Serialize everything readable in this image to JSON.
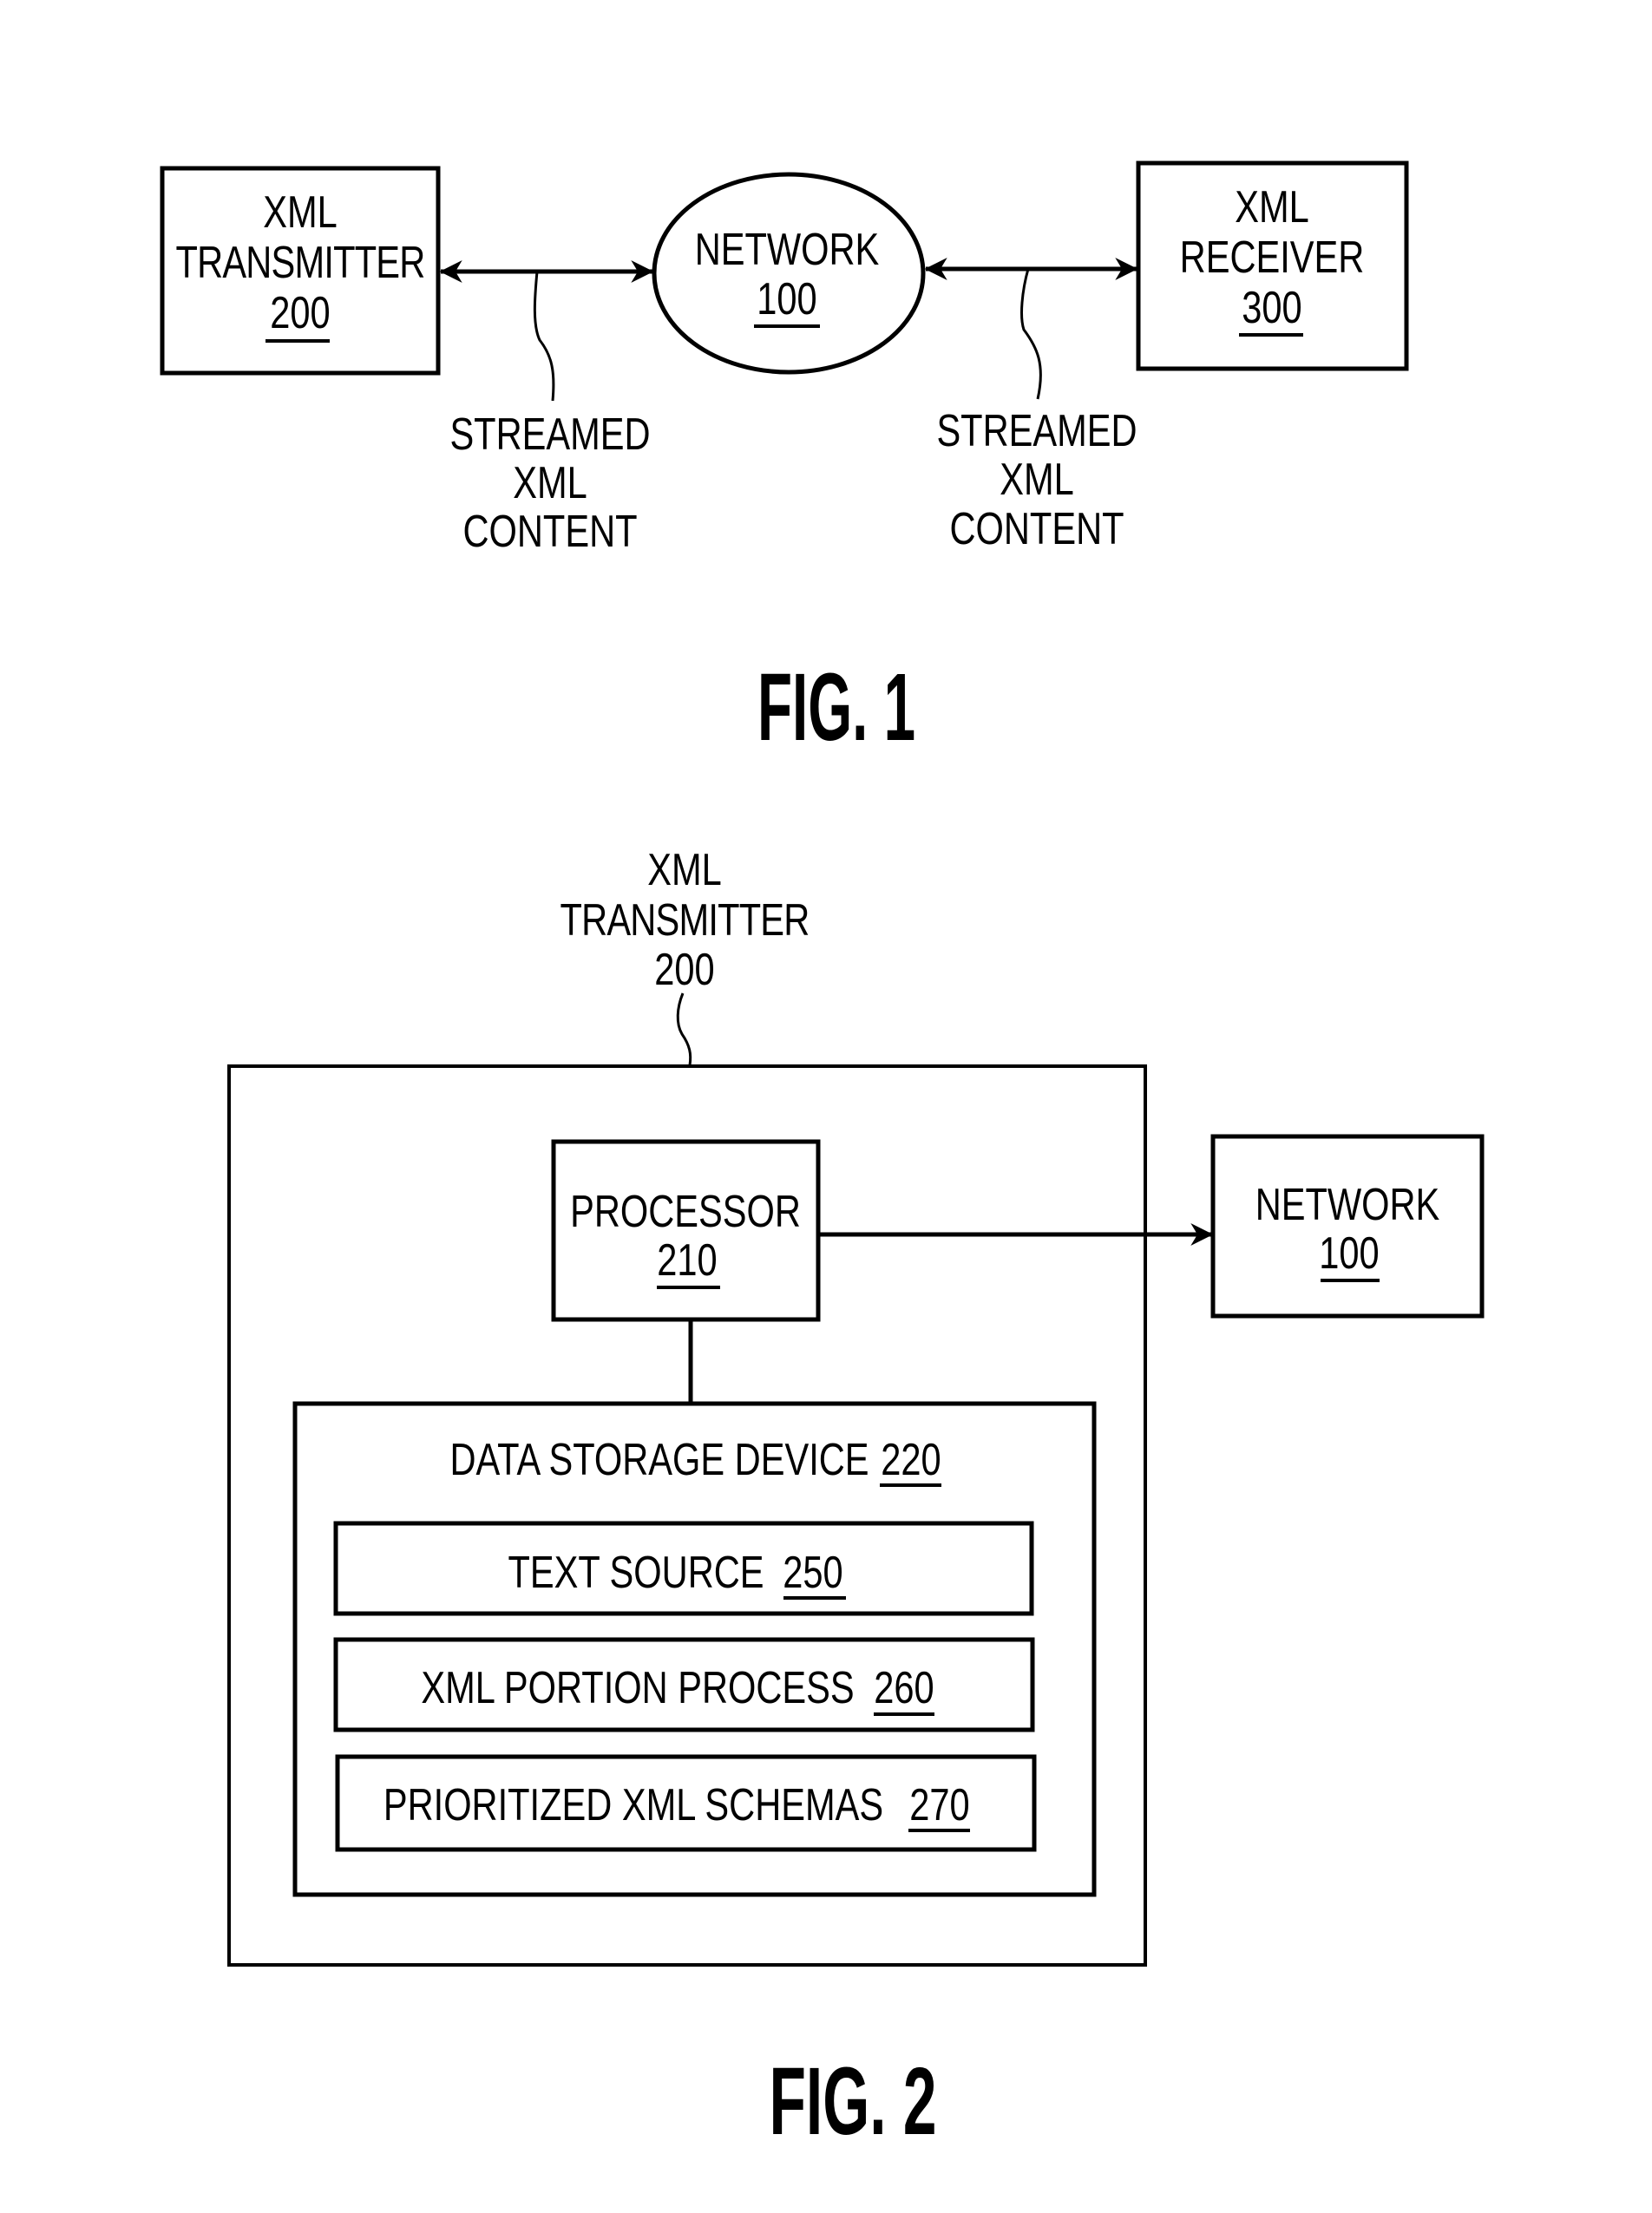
{
  "figure1": {
    "caption": "FIG. 1",
    "transmitter": {
      "line1": "XML",
      "line2": "TRANSMITTER",
      "ref": "200"
    },
    "network": {
      "line1": "NETWORK",
      "ref": "100"
    },
    "receiver": {
      "line1": "XML",
      "line2": "RECEIVER",
      "ref": "300"
    },
    "left_link_label": {
      "line1": "STREAMED",
      "line2": "XML",
      "line3": "CONTENT"
    },
    "right_link_label": {
      "line1": "STREAMED",
      "line2": "XML",
      "line3": "CONTENT"
    },
    "connections": [
      {
        "from": "XML TRANSMITTER 200",
        "to": "NETWORK 100",
        "direction": "bidirectional",
        "label": "STREAMED XML CONTENT"
      },
      {
        "from": "NETWORK 100",
        "to": "XML RECEIVER 300",
        "direction": "bidirectional",
        "label": "STREAMED XML CONTENT"
      }
    ]
  },
  "figure2": {
    "caption": "FIG. 2",
    "container_label": {
      "line1": "XML",
      "line2": "TRANSMITTER",
      "line3": "200"
    },
    "processor": {
      "line1": "PROCESSOR",
      "ref": "210"
    },
    "network": {
      "line1": "NETWORK",
      "ref": "100"
    },
    "storage": {
      "label": "DATA STORAGE DEVICE",
      "ref": "220"
    },
    "storage_items": [
      {
        "label": "TEXT SOURCE",
        "ref": "250"
      },
      {
        "label": "XML PORTION PROCESS",
        "ref": "260"
      },
      {
        "label": "PRIORITIZED XML SCHEMAS",
        "ref": "270"
      }
    ],
    "connections": [
      {
        "from": "PROCESSOR 210",
        "to": "NETWORK 100",
        "direction": "one-way"
      },
      {
        "from": "PROCESSOR 210",
        "to": "DATA STORAGE DEVICE 220",
        "direction": "link"
      }
    ]
  }
}
